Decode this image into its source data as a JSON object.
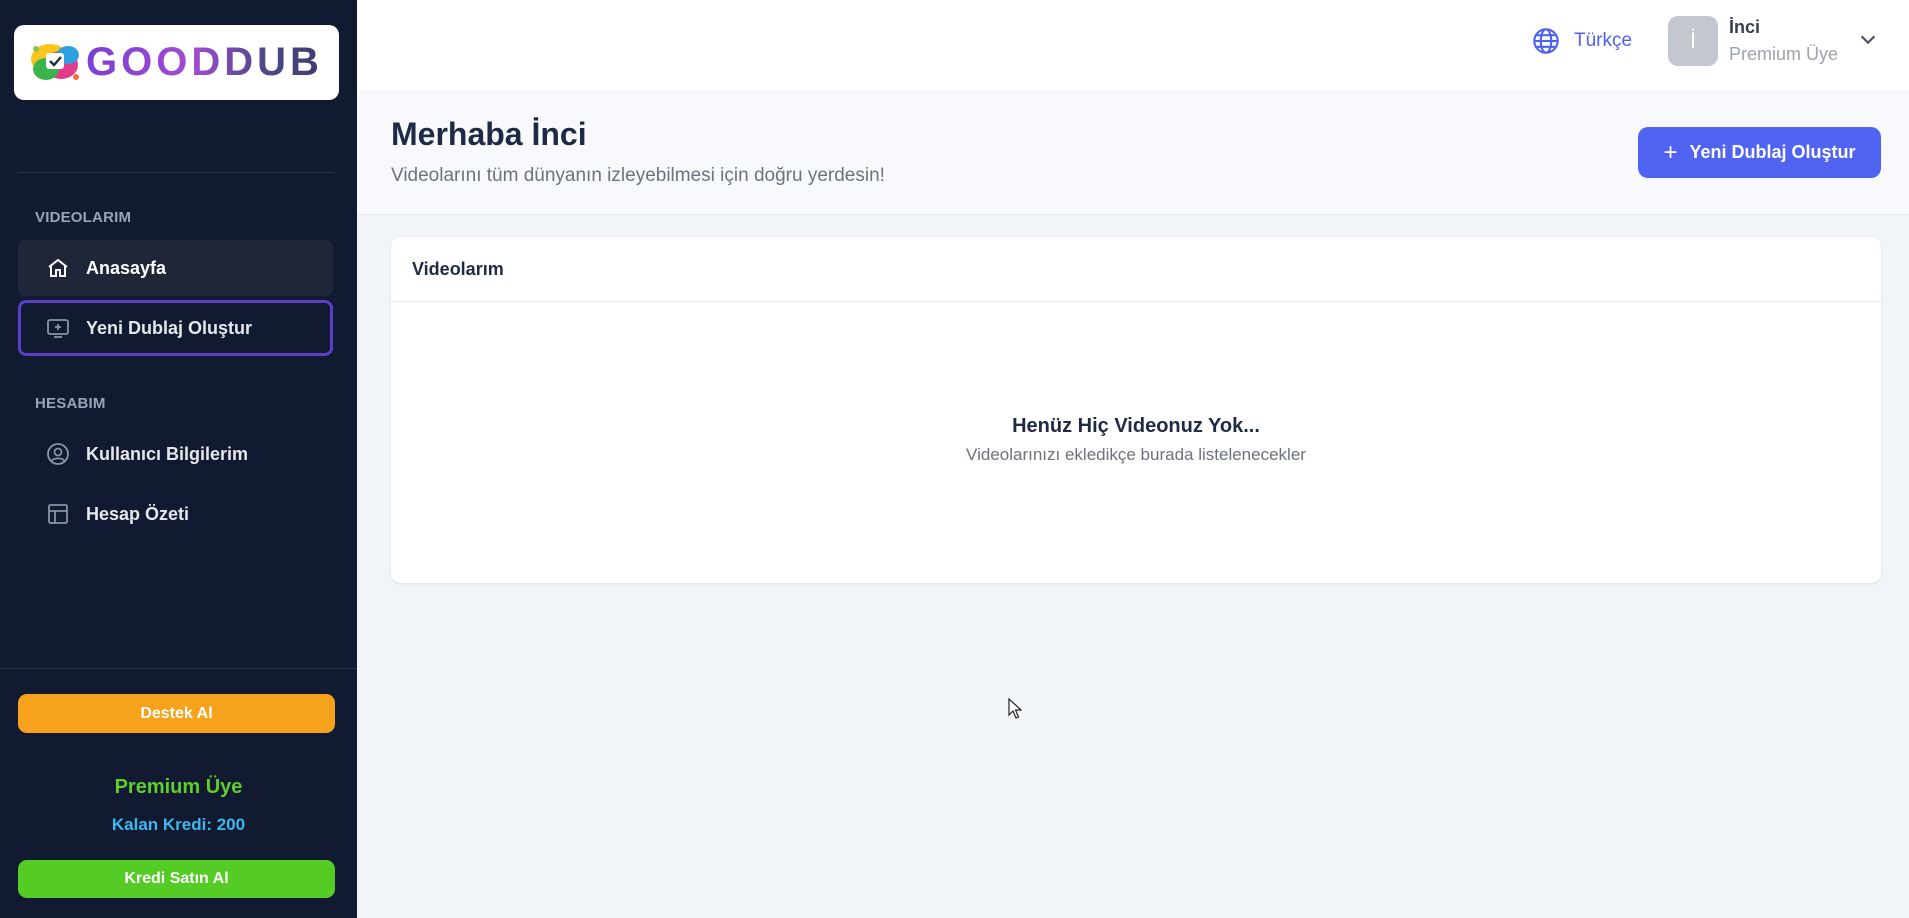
{
  "brand": {
    "logo_text": "GOODDUB"
  },
  "sidebar": {
    "sections": [
      {
        "label": "VIDEOLARIM"
      },
      {
        "label": "HESABIM"
      }
    ],
    "items": [
      {
        "label": "Anasayfa",
        "icon": "home-icon"
      },
      {
        "label": "Yeni Dublaj Oluştur",
        "icon": "screen-add-icon"
      },
      {
        "label": "Kullanıcı Bilgilerim",
        "icon": "user-circle-icon"
      },
      {
        "label": "Hesap Özeti",
        "icon": "table-icon"
      }
    ],
    "support_button": "Destek Al",
    "membership": "Premium Üye",
    "credits": "Kalan Kredi: 200",
    "buy_button": "Kredi Satın Al"
  },
  "header": {
    "language": "Türkçe",
    "avatar_initial": "İ",
    "user_name": "İnci",
    "user_role": "Premium Üye"
  },
  "page": {
    "title": "Merhaba İnci",
    "subtitle": "Videolarını tüm dünyanın izleyebilmesi için doğru yerdesin!",
    "new_button": "Yeni Dublaj Oluştur"
  },
  "card": {
    "title": "Videolarım",
    "empty_title": "Henüz Hiç Videonuz Yok...",
    "empty_subtitle": "Videolarınızı ekledikçe burada listelenecekler"
  },
  "colors": {
    "sidebar_bg": "#111a30",
    "accent": "#5164f1",
    "support": "#f6a21d",
    "buy": "#55cc25",
    "premium": "#5ccf2f",
    "credits": "#3cb8ee"
  }
}
